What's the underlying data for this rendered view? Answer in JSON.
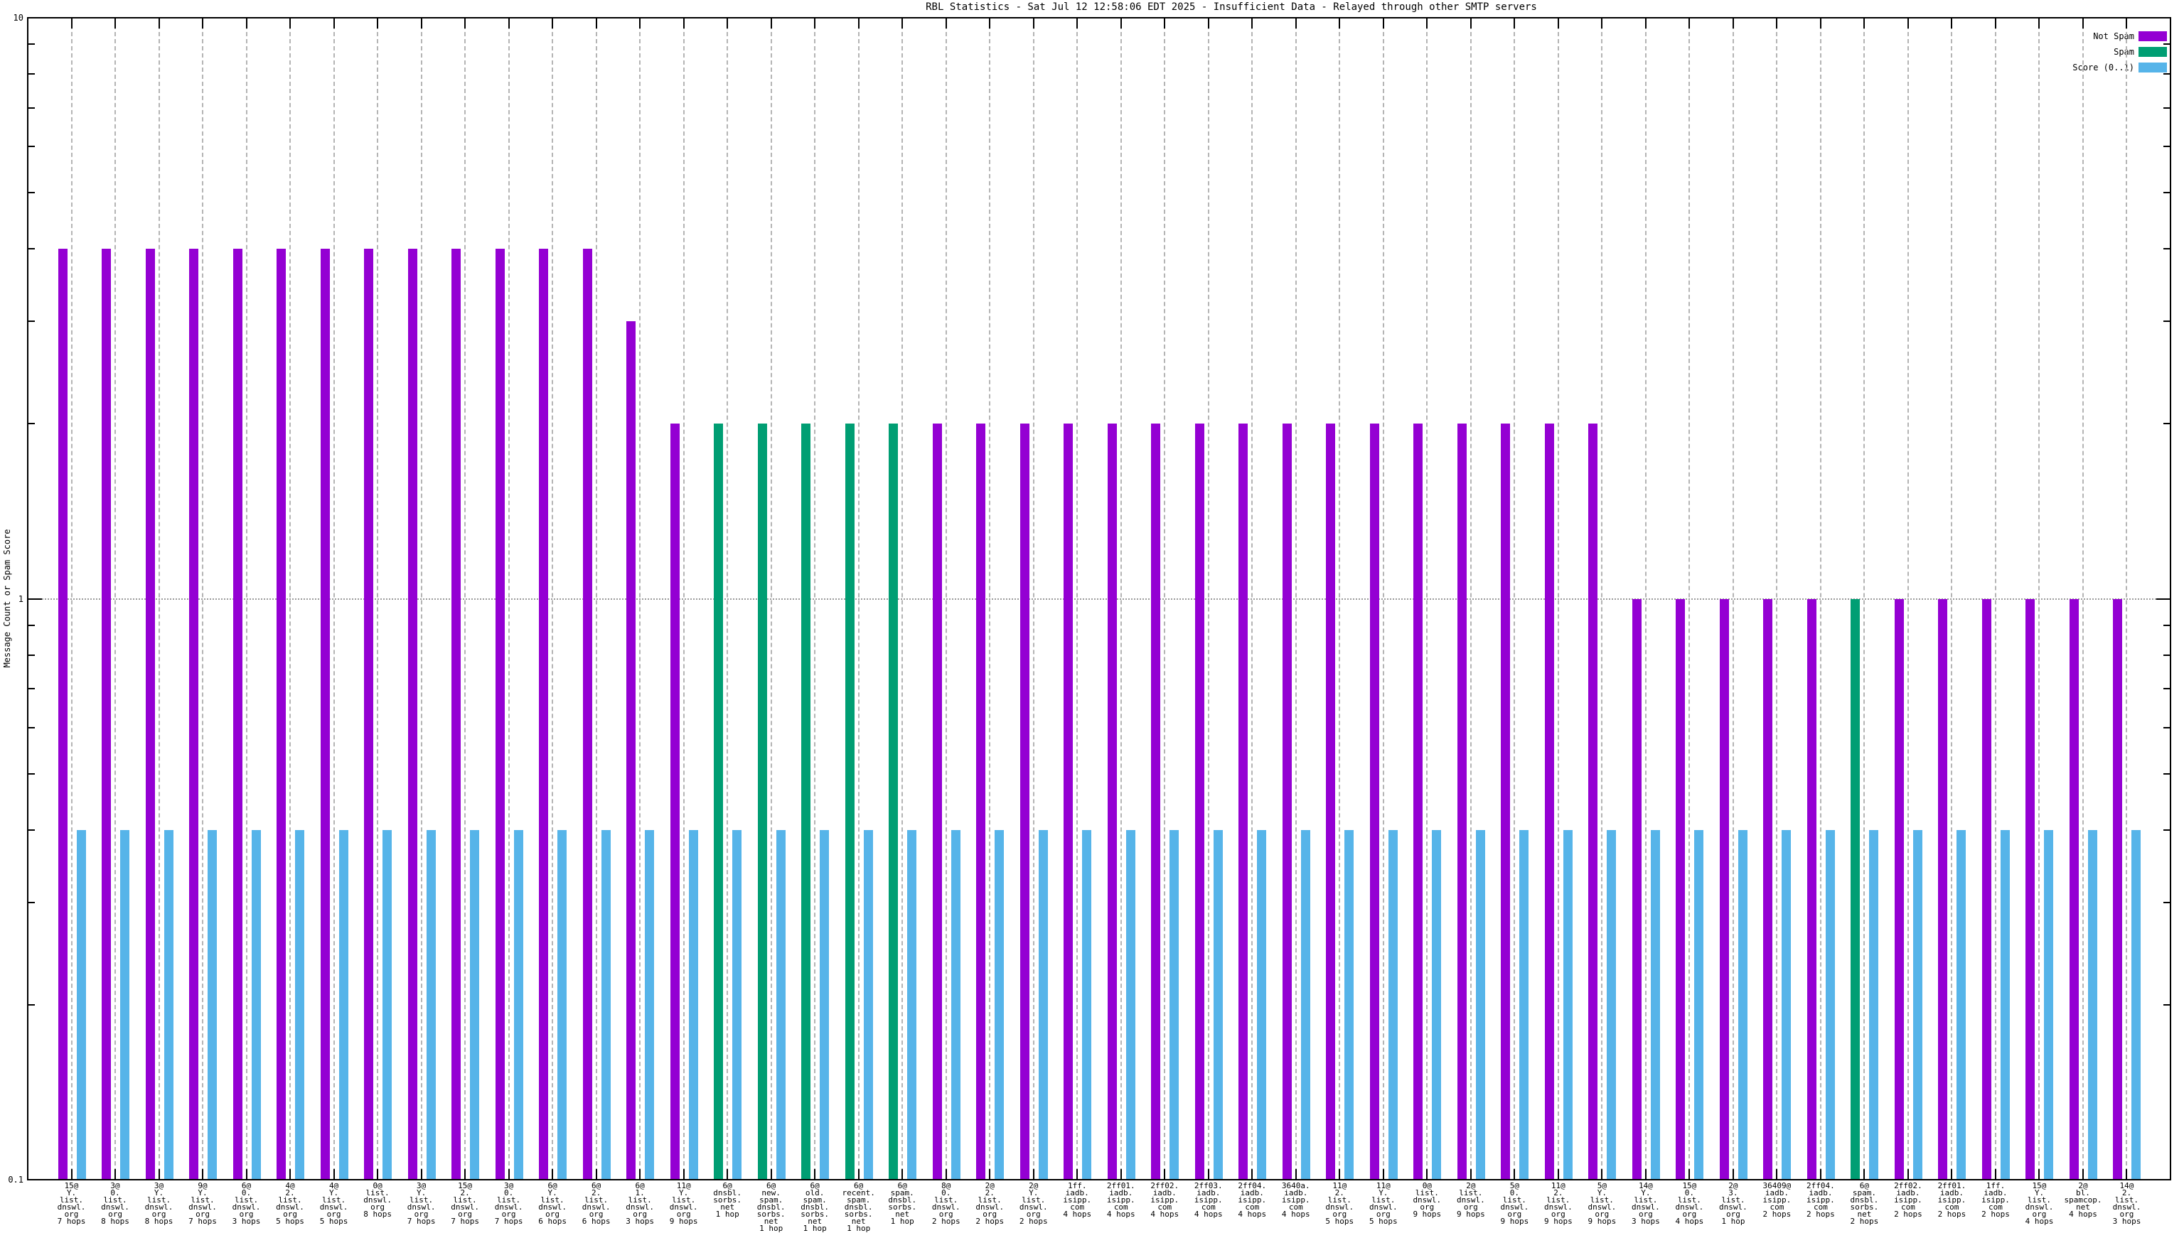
{
  "chart_data": {
    "type": "bar",
    "title": "RBL Statistics - Sat Jul 12 12:58:06 EDT 2025 - Insufficient Data - Relayed through other SMTP servers",
    "ylabel": "Message Count or Spam Score",
    "yscale": "log",
    "ylim": [
      0.1,
      10
    ],
    "ytick_labels": [
      "0.1",
      "1",
      "10"
    ],
    "grid": true,
    "legend_position": "top-right",
    "legend": [
      {
        "label": "Not Spam",
        "color": "#9400d3",
        "series": "not_spam"
      },
      {
        "label": "Spam",
        "color": "#009e73",
        "series": "spam"
      },
      {
        "label": "Score (0..1)",
        "color": "#56b4e9",
        "series": "score"
      }
    ],
    "colors": {
      "not_spam": "#9400d3",
      "spam": "#009e73",
      "score": "#56b4e9"
    },
    "groups": [
      {
        "label_lines": [
          "15@",
          "Y.",
          "list.",
          "dnswl.",
          "org",
          "7 hops"
        ],
        "series": "not_spam",
        "value": 4,
        "score": 0.4
      },
      {
        "label_lines": [
          "3@",
          "0.",
          "list.",
          "dnswl.",
          "org",
          "8 hops"
        ],
        "series": "not_spam",
        "value": 4,
        "score": 0.4
      },
      {
        "label_lines": [
          "3@",
          "Y.",
          "list.",
          "dnswl.",
          "org",
          "8 hops"
        ],
        "series": "not_spam",
        "value": 4,
        "score": 0.4
      },
      {
        "label_lines": [
          "9@",
          "Y.",
          "list.",
          "dnswl.",
          "org",
          "7 hops"
        ],
        "series": "not_spam",
        "value": 4,
        "score": 0.4
      },
      {
        "label_lines": [
          "6@",
          "0.",
          "list.",
          "dnswl.",
          "org",
          "3 hops"
        ],
        "series": "not_spam",
        "value": 4,
        "score": 0.4
      },
      {
        "label_lines": [
          "4@",
          "2.",
          "list.",
          "dnswl.",
          "org",
          "5 hops"
        ],
        "series": "not_spam",
        "value": 4,
        "score": 0.4
      },
      {
        "label_lines": [
          "4@",
          "Y.",
          "list.",
          "dnswl.",
          "org",
          "5 hops"
        ],
        "series": "not_spam",
        "value": 4,
        "score": 0.4
      },
      {
        "label_lines": [
          "0@",
          "list.",
          "dnswl.",
          "org",
          "8 hops"
        ],
        "series": "not_spam",
        "value": 4,
        "score": 0.4
      },
      {
        "label_lines": [
          "3@",
          "Y.",
          "list.",
          "dnswl.",
          "org",
          "7 hops"
        ],
        "series": "not_spam",
        "value": 4,
        "score": 0.4
      },
      {
        "label_lines": [
          "15@",
          "2.",
          "list.",
          "dnswl.",
          "org",
          "7 hops"
        ],
        "series": "not_spam",
        "value": 4,
        "score": 0.4
      },
      {
        "label_lines": [
          "3@",
          "0.",
          "list.",
          "dnswl.",
          "org",
          "7 hops"
        ],
        "series": "not_spam",
        "value": 4,
        "score": 0.4
      },
      {
        "label_lines": [
          "6@",
          "Y.",
          "list.",
          "dnswl.",
          "org",
          "6 hops"
        ],
        "series": "not_spam",
        "value": 4,
        "score": 0.4
      },
      {
        "label_lines": [
          "6@",
          "2.",
          "list.",
          "dnswl.",
          "org",
          "6 hops"
        ],
        "series": "not_spam",
        "value": 4,
        "score": 0.4
      },
      {
        "label_lines": [
          "6@",
          "1.",
          "list.",
          "dnswl.",
          "org",
          "3 hops"
        ],
        "series": "not_spam",
        "value": 3,
        "score": 0.4
      },
      {
        "label_lines": [
          "11@",
          "Y.",
          "list.",
          "dnswl.",
          "org",
          "9 hops"
        ],
        "series": "not_spam",
        "value": 2,
        "score": 0.4
      },
      {
        "label_lines": [
          "6@",
          "dnsbl.",
          "sorbs.",
          "net",
          "1 hop"
        ],
        "series": "spam",
        "value": 2,
        "score": 0.4
      },
      {
        "label_lines": [
          "6@",
          "new.",
          "spam.",
          "dnsbl.",
          "sorbs.",
          "net",
          "1 hop"
        ],
        "series": "spam",
        "value": 2,
        "score": 0.4
      },
      {
        "label_lines": [
          "6@",
          "old.",
          "spam.",
          "dnsbl.",
          "sorbs.",
          "net",
          "1 hop"
        ],
        "series": "spam",
        "value": 2,
        "score": 0.4
      },
      {
        "label_lines": [
          "6@",
          "recent.",
          "spam.",
          "dnsbl.",
          "sorbs.",
          "net",
          "1 hop"
        ],
        "series": "spam",
        "value": 2,
        "score": 0.4
      },
      {
        "label_lines": [
          "6@",
          "spam.",
          "dnsbl.",
          "sorbs.",
          "net",
          "1 hop"
        ],
        "series": "spam",
        "value": 2,
        "score": 0.4
      },
      {
        "label_lines": [
          "8@",
          "0.",
          "list.",
          "dnswl.",
          "org",
          "2 hops"
        ],
        "series": "not_spam",
        "value": 2,
        "score": 0.4
      },
      {
        "label_lines": [
          "2@",
          "2.",
          "list.",
          "dnswl.",
          "org",
          "2 hops"
        ],
        "series": "not_spam",
        "value": 2,
        "score": 0.4
      },
      {
        "label_lines": [
          "2@",
          "Y.",
          "list.",
          "dnswl.",
          "org",
          "2 hops"
        ],
        "series": "not_spam",
        "value": 2,
        "score": 0.4
      },
      {
        "label_lines": [
          "1ff.",
          "iadb.",
          "isipp.",
          "com",
          "4 hops"
        ],
        "series": "not_spam",
        "value": 2,
        "score": 0.4
      },
      {
        "label_lines": [
          "2ff01.",
          "iadb.",
          "isipp.",
          "com",
          "4 hops"
        ],
        "series": "not_spam",
        "value": 2,
        "score": 0.4
      },
      {
        "label_lines": [
          "2ff02.",
          "iadb.",
          "isipp.",
          "com",
          "4 hops"
        ],
        "series": "not_spam",
        "value": 2,
        "score": 0.4
      },
      {
        "label_lines": [
          "2ff03.",
          "iadb.",
          "isipp.",
          "com",
          "4 hops"
        ],
        "series": "not_spam",
        "value": 2,
        "score": 0.4
      },
      {
        "label_lines": [
          "2ff04.",
          "iadb.",
          "isipp.",
          "com",
          "4 hops"
        ],
        "series": "not_spam",
        "value": 2,
        "score": 0.4
      },
      {
        "label_lines": [
          "3640a.",
          "iadb.",
          "isipp.",
          "com",
          "4 hops"
        ],
        "series": "not_spam",
        "value": 2,
        "score": 0.4
      },
      {
        "label_lines": [
          "11@",
          "2.",
          "list.",
          "dnswl.",
          "org",
          "5 hops"
        ],
        "series": "not_spam",
        "value": 2,
        "score": 0.4
      },
      {
        "label_lines": [
          "11@",
          "Y.",
          "list.",
          "dnswl.",
          "org",
          "5 hops"
        ],
        "series": "not_spam",
        "value": 2,
        "score": 0.4
      },
      {
        "label_lines": [
          "0@",
          "list.",
          "dnswl.",
          "org",
          "9 hops"
        ],
        "series": "not_spam",
        "value": 2,
        "score": 0.4
      },
      {
        "label_lines": [
          "2@",
          "list.",
          "dnswl.",
          "org",
          "9 hops"
        ],
        "series": "not_spam",
        "value": 2,
        "score": 0.4
      },
      {
        "label_lines": [
          "5@",
          "0.",
          "list.",
          "dnswl.",
          "org",
          "9 hops"
        ],
        "series": "not_spam",
        "value": 2,
        "score": 0.4
      },
      {
        "label_lines": [
          "11@",
          "2.",
          "list.",
          "dnswl.",
          "org",
          "9 hops"
        ],
        "series": "not_spam",
        "value": 2,
        "score": 0.4
      },
      {
        "label_lines": [
          "5@",
          "Y.",
          "list.",
          "dnswl.",
          "org",
          "9 hops"
        ],
        "series": "not_spam",
        "value": 2,
        "score": 0.4
      },
      {
        "label_lines": [
          "14@",
          "Y.",
          "list.",
          "dnswl.",
          "org",
          "3 hops"
        ],
        "series": "not_spam",
        "value": 1,
        "score": 0.4
      },
      {
        "label_lines": [
          "15@",
          "0.",
          "list.",
          "dnswl.",
          "org",
          "4 hops"
        ],
        "series": "not_spam",
        "value": 1,
        "score": 0.4
      },
      {
        "label_lines": [
          "2@",
          "3.",
          "list.",
          "dnswl.",
          "org",
          "1 hop"
        ],
        "series": "not_spam",
        "value": 1,
        "score": 0.4
      },
      {
        "label_lines": [
          "36409@",
          "iadb.",
          "isipp.",
          "com",
          "2 hops"
        ],
        "series": "not_spam",
        "value": 1,
        "score": 0.4
      },
      {
        "label_lines": [
          "2ff04.",
          "iadb.",
          "isipp.",
          "com",
          "2 hops"
        ],
        "series": "not_spam",
        "value": 1,
        "score": 0.4
      },
      {
        "label_lines": [
          "6@",
          "spam.",
          "dnsbl.",
          "sorbs.",
          "net",
          "2 hops"
        ],
        "series": "spam",
        "value": 1,
        "score": 0.4
      },
      {
        "label_lines": [
          "2ff02.",
          "iadb.",
          "isipp.",
          "com",
          "2 hops"
        ],
        "series": "not_spam",
        "value": 1,
        "score": 0.4
      },
      {
        "label_lines": [
          "2ff01.",
          "iadb.",
          "isipp.",
          "com",
          "2 hops"
        ],
        "series": "not_spam",
        "value": 1,
        "score": 0.4
      },
      {
        "label_lines": [
          "1ff.",
          "iadb.",
          "isipp.",
          "com",
          "2 hops"
        ],
        "series": "not_spam",
        "value": 1,
        "score": 0.4
      },
      {
        "label_lines": [
          "15@",
          "Y.",
          "list.",
          "dnswl.",
          "org",
          "4 hops"
        ],
        "series": "not_spam",
        "value": 1,
        "score": 0.4
      },
      {
        "label_lines": [
          "2@",
          "bl.",
          "spamcop.",
          "net",
          "4 hops"
        ],
        "series": "not_spam",
        "value": 1,
        "score": 0.4
      },
      {
        "label_lines": [
          "14@",
          "2.",
          "list.",
          "dnswl.",
          "org",
          "3 hops"
        ],
        "series": "not_spam",
        "value": 1,
        "score": 0.4
      }
    ]
  }
}
